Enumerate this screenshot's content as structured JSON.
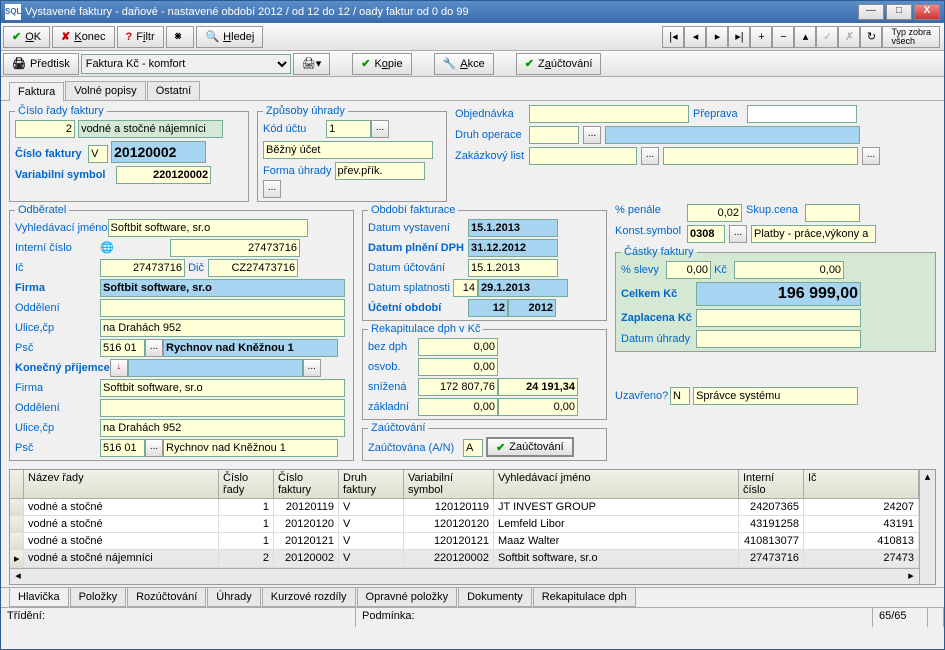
{
  "title": "Vystavené faktury - daňové - nastavené období 2012 / od 12 do 12 / oady faktur od 0 do 99",
  "tb": {
    "ok": "OK",
    "konec": "Konec",
    "filtr": "Filtr",
    "hledej": "Hledej",
    "typ": "Typ zobra\nvšech"
  },
  "tb2": {
    "predtisk": "Předtisk",
    "sel": "Faktura Kč - komfort",
    "kopie": "Kopie",
    "akce": "Akce",
    "zauc": "Zaúčtování"
  },
  "tabs": [
    "Faktura",
    "Volné popisy",
    "Ostatní"
  ],
  "crf": {
    "leg": "Číslo řady faktury",
    "n": "2",
    "t": "vodné a stočné nájemníci",
    "cfl": "Číslo faktury",
    "cfp": "V",
    "cfn": "20120002",
    "vsl": "Variabilní symbol",
    "vsn": "220120002"
  },
  "zu": {
    "leg": "Způsoby úhrady",
    "kul": "Kód účtu",
    "kun": "1",
    "bu": "Běžný účet",
    "ful": "Forma úhrady",
    "fut": "přev.přík."
  },
  "top": {
    "obj": "Objednávka",
    "pre": "Přeprava",
    "do": "Druh operace",
    "zl": "Zakázkový list"
  },
  "od": {
    "leg": "Odběratel",
    "vjl": "Vyhledávací jméno",
    "vjt": "Softbit software, sr.o",
    "icl": "Interní číslo",
    "icn": "27473716",
    "il": "Ič",
    "in": "27473716",
    "dl": "Dič",
    "dt": "CZ27473716",
    "fl": "Firma",
    "ft": "Softbit software, sr.o",
    "ol": "Oddělení",
    "ul": "Ulice,čp",
    "ut": "na Drahách 952",
    "pl": "Psč",
    "pt": "516 01",
    "mt": "Rychnov nad Kněžnou 1",
    "kpl": "Konečný příjemce"
  },
  "of": {
    "leg": "Období fakturace",
    "dvl": "Datum vystavení",
    "dvt": "15.1.2013",
    "dpl": "Datum plnění DPH",
    "dpt": "31.12.2012",
    "dul": "Datum účtování",
    "dut": "15.1.2013",
    "dsl": "Datum splatnosti",
    "dsn": "14",
    "dst": "29.1.2013",
    "uol": "Účetní období",
    "uon1": "12",
    "uon2": "2012"
  },
  "rk": {
    "leg": "Rekapitulace dph v Kč",
    "bd": "bez dph",
    "bdn": "0,00",
    "os": "osvob.",
    "osn": "0,00",
    "sn": "snížená",
    "snn1": "172 807,76",
    "snn2": "24 191,34",
    "zk": "základní",
    "zkn1": "0,00",
    "zkn2": "0,00"
  },
  "za": {
    "leg": "Zaúčtování",
    "zl": "Zaúčtována (A/N)",
    "zt": "A",
    "zb": "Zaúčtování",
    "uzl": "Uzavřeno?",
    "uzt": "N",
    "sp": "Správce systému"
  },
  "pr": {
    "pel": "% penále",
    "pet": "0,02",
    "scl": "Skup.cena",
    "ksl": "Konst.symbol",
    "kst": "0308",
    "pb": "Platby - práce,výkony a"
  },
  "cf": {
    "leg": "Částky faktury",
    "sl": "% slevy",
    "sn": "0,00",
    "kc": "Kč",
    "kcn": "0,00",
    "cl": "Celkem Kč",
    "cn": "196 999,00",
    "zl": "Zaplacena Kč",
    "dl": "Datum úhrady"
  },
  "grid": {
    "h": [
      "Název řady",
      "Číslo řady",
      "Číslo faktury",
      "Druh faktury",
      "Variabilní symbol",
      "Vyhledávací jméno",
      "Interní číslo",
      "Ič"
    ],
    "r": [
      [
        "vodné a stočné",
        "1",
        "20120119",
        "V",
        "120120119",
        "JT INVEST GROUP",
        "24207365",
        "24207"
      ],
      [
        "vodné a stočné",
        "1",
        "20120120",
        "V",
        "120120120",
        "Lemfeld Libor",
        "43191258",
        "43191"
      ],
      [
        "vodné a stočné",
        "1",
        "20120121",
        "V",
        "120120121",
        "Maaz Walter",
        "410813077",
        "410813"
      ],
      [
        "vodné a stočné nájemníci",
        "2",
        "20120002",
        "V",
        "220120002",
        "Softbit software, sr.o",
        "27473716",
        "27473"
      ]
    ]
  },
  "btabs": [
    "Hlavička",
    "Položky",
    "Rozúčtování",
    "Úhrady",
    "Kurzové rozdíly",
    "Opravné položky",
    "Dokumenty",
    "Rekapitulace dph"
  ],
  "st": {
    "tr": "Třídění:",
    "po": "Podmínka:",
    "pg": "65/65"
  }
}
